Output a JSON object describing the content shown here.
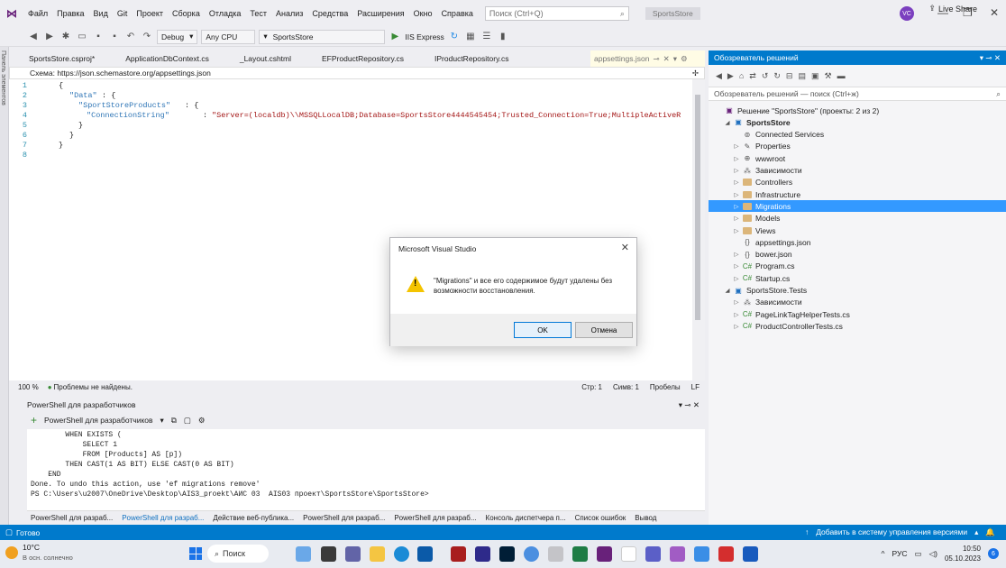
{
  "titlebar": {
    "menu": [
      "Файл",
      "Правка",
      "Вид",
      "Git",
      "Проект",
      "Сборка",
      "Отладка",
      "Тест",
      "Анализ",
      "Средства",
      "Расширения",
      "Окно",
      "Справка"
    ],
    "search_placeholder": "Поиск (Ctrl+Q)",
    "project_name": "SportsStore",
    "avatar_initials": "VC"
  },
  "toolbar": {
    "config": "Debug",
    "platform": "Any CPU",
    "project": "SportsStore",
    "run_target": "IIS Express",
    "live_share": "Live Share"
  },
  "leftstrip": {
    "label": "Панель элементов"
  },
  "editor": {
    "tabs": [
      "SportsStore.csproj*",
      "ApplicationDbContext.cs",
      "_Layout.cshtml",
      "EFProductRepository.cs",
      "IProductRepository.cs"
    ],
    "active_tab": "appsettings.json",
    "schema": "Схема: https://json.schemastore.org/appsettings.json",
    "line_numbers": [
      "1",
      "2",
      "3",
      "4",
      "5",
      "6",
      "7",
      "8"
    ],
    "code": {
      "l1": "{",
      "l2_key": "\"Data\"",
      "l2_rest": ": {",
      "l3_key": "\"SportStoreProducts\"",
      "l3_rest": ": {",
      "l4_key": "\"ConnectionString\"",
      "l4_sep": ": ",
      "l4_val": "\"Server=(localdb)\\\\MSSQLLocalDB;Database=SportsStore4444545454;Trusted_Connection=True;MultipleActiveR",
      "l5": "}",
      "l6": "}",
      "l7": "}"
    },
    "status": {
      "zoom": "100 %",
      "problems": "Проблемы не найдены.",
      "line": "Стр: 1",
      "col": "Симв: 1",
      "spaces": "Пробелы",
      "eol": "LF"
    }
  },
  "powershell": {
    "title": "PowerShell для разработчиков",
    "dropdown": "PowerShell для разработчиков",
    "output": [
      "        WHEN EXISTS (",
      "            SELECT 1",
      "            FROM [Products] AS [p])",
      "        THEN CAST(1 AS BIT) ELSE CAST(0 AS BIT)",
      "    END",
      "Done. To undo this action, use 'ef migrations remove'",
      "PS C:\\Users\\u2007\\OneDrive\\Desktop\\AIS3_proekt\\АИС 03  AIS03 проект\\SportsStore\\SportsStore>"
    ],
    "tabs": [
      "PowerShell для разраб...",
      "PowerShell для разраб...",
      "Действие веб-публика...",
      "PowerShell для разраб...",
      "PowerShell для разраб...",
      "Консоль диспетчера п...",
      "Список ошибок",
      "Вывод"
    ]
  },
  "solution_explorer": {
    "title": "Обозреватель решений",
    "search_placeholder": "Обозреватель решений — поиск (Ctrl+ж)",
    "nodes": [
      {
        "label": "Решение \"SportsStore\" (проекты: 2 из 2)",
        "indent": 0,
        "arrow": "",
        "icon": "solution-icon"
      },
      {
        "label": "SportsStore",
        "indent": 1,
        "arrow": "◢",
        "icon": "project-icon",
        "bold": true
      },
      {
        "label": "Connected Services",
        "indent": 2,
        "arrow": "",
        "icon": "connected-services-icon"
      },
      {
        "label": "Properties",
        "indent": 2,
        "arrow": "▷",
        "icon": "properties-icon"
      },
      {
        "label": "wwwroot",
        "indent": 2,
        "arrow": "▷",
        "icon": "globe-icon"
      },
      {
        "label": "Зависимости",
        "indent": 2,
        "arrow": "▷",
        "icon": "dependencies-icon"
      },
      {
        "label": "Controllers",
        "indent": 2,
        "arrow": "▷",
        "icon": "folder-icon"
      },
      {
        "label": "Infrastructure",
        "indent": 2,
        "arrow": "▷",
        "icon": "folder-icon"
      },
      {
        "label": "Migrations",
        "indent": 2,
        "arrow": "▷",
        "icon": "folder-icon",
        "selected": true
      },
      {
        "label": "Models",
        "indent": 2,
        "arrow": "▷",
        "icon": "folder-icon"
      },
      {
        "label": "Views",
        "indent": 2,
        "arrow": "▷",
        "icon": "folder-icon"
      },
      {
        "label": "appsettings.json",
        "indent": 2,
        "arrow": "",
        "icon": "json-file-icon"
      },
      {
        "label": "bower.json",
        "indent": 2,
        "arrow": "▷",
        "icon": "json-file-icon"
      },
      {
        "label": "Program.cs",
        "indent": 2,
        "arrow": "▷",
        "icon": "csharp-file-icon"
      },
      {
        "label": "Startup.cs",
        "indent": 2,
        "arrow": "▷",
        "icon": "csharp-file-icon"
      },
      {
        "label": "SportsStore.Tests",
        "indent": 1,
        "arrow": "◢",
        "icon": "test-project-icon"
      },
      {
        "label": "Зависимости",
        "indent": 2,
        "arrow": "▷",
        "icon": "dependencies-icon"
      },
      {
        "label": "PageLinkTagHelperTests.cs",
        "indent": 2,
        "arrow": "▷",
        "icon": "csharp-file-icon"
      },
      {
        "label": "ProductControllerTests.cs",
        "indent": 2,
        "arrow": "▷",
        "icon": "csharp-file-icon"
      }
    ]
  },
  "statusbar": {
    "ready": "Готово",
    "source_control": "Добавить в систему управления версиями"
  },
  "dialog": {
    "title": "Microsoft Visual Studio",
    "message": "\"Migrations\" и все его содержимое будут удалены без возможности восстановления.",
    "ok": "OK",
    "cancel": "Отмена"
  },
  "taskbar": {
    "temp": "10°C",
    "weather": "В осн. солнечно",
    "search": "Поиск",
    "lang": "РУС",
    "time": "10:50",
    "date": "05.10.2023",
    "notifications": "6"
  }
}
